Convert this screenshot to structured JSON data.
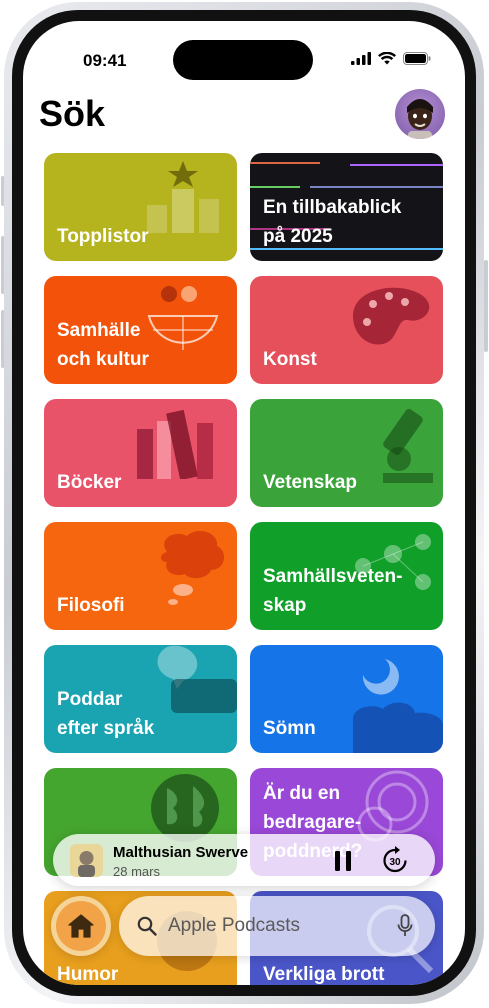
{
  "status_bar": {
    "time": "09:41"
  },
  "header": {
    "title": "Sök"
  },
  "categories": [
    {
      "label": "Topplistor",
      "color": "#b5b31e"
    },
    {
      "label": "En tillbakablick\npå 2025",
      "color": "#141418"
    },
    {
      "label": "Samhälle\noch kultur",
      "color": "#f2520a"
    },
    {
      "label": "Konst",
      "color": "#e5505a"
    },
    {
      "label": "Böcker",
      "color": "#e8536a"
    },
    {
      "label": "Vetenskap",
      "color": "#3aa33a"
    },
    {
      "label": "Filosofi",
      "color": "#f5660e"
    },
    {
      "label": "Samhällsveten-\nskap",
      "color": "#10a02a"
    },
    {
      "label": "Poddar\nefter språk",
      "color": "#1aa3b1"
    },
    {
      "label": "Sömn",
      "color": "#1575e8"
    },
    {
      "label": "",
      "color": "#45a62f"
    },
    {
      "label": "Är du en\nbedragare-poddnerd?",
      "color": "#9a48d8"
    },
    {
      "label": "Humor",
      "color": "#e99f1e"
    },
    {
      "label": "Verkliga brott",
      "color": "#4a55c8"
    }
  ],
  "now_playing": {
    "title": "Malthusian Swerve",
    "subtitle": "28 mars",
    "skip_seconds": "30"
  },
  "tab_bar": {
    "search_placeholder": "Apple Podcasts"
  },
  "icons": {
    "home": "house-icon",
    "search": "magnifier-icon",
    "mic": "microphone-icon",
    "pause": "pause-icon",
    "skip": "skip-forward-30-icon"
  }
}
